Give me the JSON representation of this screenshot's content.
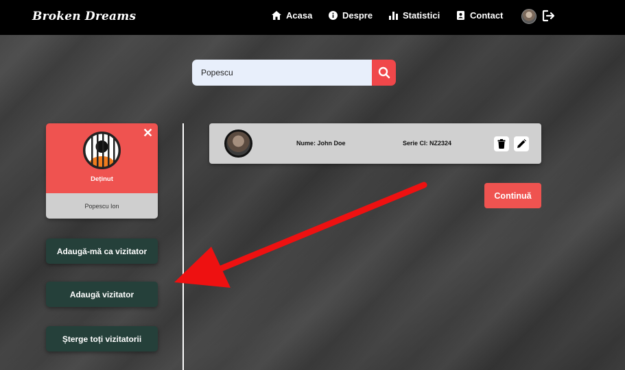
{
  "brand": "Broken Dreams",
  "nav": {
    "home": "Acasa",
    "about": "Despre",
    "stats": "Statistici",
    "contact": "Contact"
  },
  "search": {
    "value": "Popescu",
    "placeholder": ""
  },
  "inmate": {
    "role": "Deținut",
    "name": "Popescu Ion"
  },
  "sidebar": {
    "add_me": "Adaugă-mă ca vizitator",
    "add_visitor": "Adaugă vizitator",
    "delete_all": "Șterge toți vizitatorii"
  },
  "visitors": [
    {
      "name": "Nume: John Doe",
      "serie": "Serie CI: NZ2324"
    }
  ],
  "continue_label": "Continuă",
  "colors": {
    "accent_red": "#ef5350",
    "dark_green": "#25403a",
    "navbar": "#000000"
  },
  "icons": [
    "home-icon",
    "info-icon",
    "stats-icon",
    "contact-icon",
    "logout-icon",
    "search-icon",
    "close-icon",
    "trash-icon",
    "edit-icon",
    "prisoner-icon"
  ]
}
